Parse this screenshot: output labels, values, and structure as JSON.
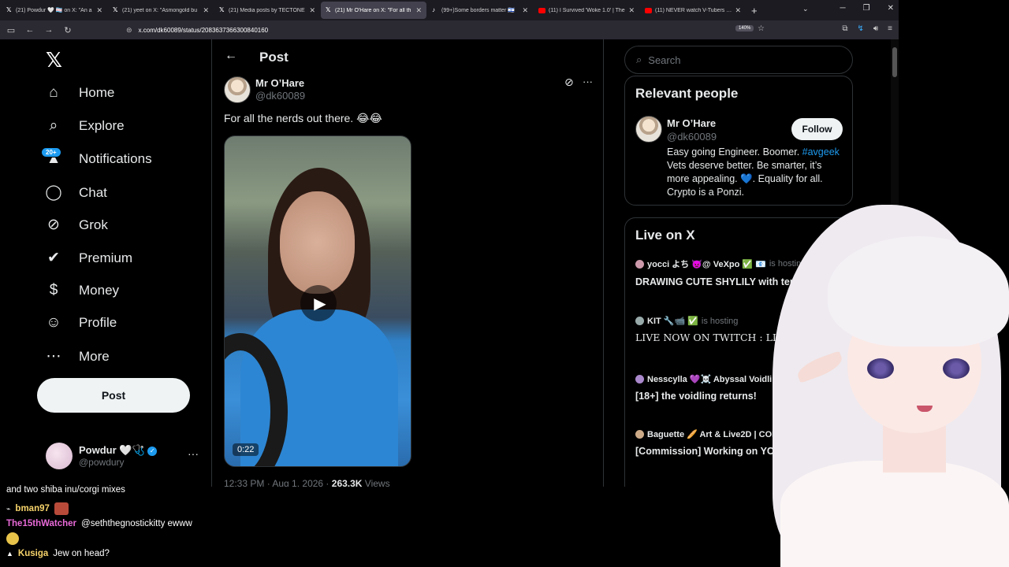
{
  "browser": {
    "tabs": [
      {
        "icon": "x-logo-icon",
        "title": "(21) Powdur 🤍 🏳️‍⚧️ on X: \"An a"
      },
      {
        "icon": "x-logo-icon",
        "title": "(21) yeet on X: \"Asmongold bu"
      },
      {
        "icon": "x-logo-icon",
        "title": "(21) Media posts by TECTONE"
      },
      {
        "icon": "x-logo-icon",
        "title": "(21) Mr O'Hare on X: \"For all th"
      },
      {
        "icon": "tiktok-icon",
        "title": "(99+)Some borders matter 🇮🇱"
      },
      {
        "icon": "youtube-icon",
        "title": "(11) I Survived 'Woke 1.0' | The"
      },
      {
        "icon": "youtube-icon",
        "title": "(11) NEVER watch V-Tubers - Y"
      }
    ],
    "active_tab": 3,
    "url": "x.com/dk60089/status/2083637366300840160",
    "zoom": "140%"
  },
  "nav": {
    "items": [
      {
        "label": "Home",
        "icon": "home-icon",
        "glyph": "⌂"
      },
      {
        "label": "Explore",
        "icon": "search-icon",
        "glyph": "⌕"
      },
      {
        "label": "Notifications",
        "icon": "bell-icon",
        "glyph": "▲"
      },
      {
        "label": "Chat",
        "icon": "chat-icon",
        "glyph": "◯"
      },
      {
        "label": "Grok",
        "icon": "grok-icon",
        "glyph": "⊘"
      },
      {
        "label": "Premium",
        "icon": "premium-icon",
        "glyph": "✔"
      },
      {
        "label": "Money",
        "icon": "money-icon",
        "glyph": "$"
      },
      {
        "label": "Profile",
        "icon": "profile-icon",
        "glyph": "☺"
      },
      {
        "label": "More",
        "icon": "more-icon",
        "glyph": "⋯"
      }
    ],
    "notif_badge": "20+",
    "post_button": "Post",
    "account": {
      "name": "Powdur 🤍🩺",
      "handle": "@powdury"
    }
  },
  "post": {
    "header": "Post",
    "author_name": "Mr O’Hare",
    "author_handle": "@dk60089",
    "text": "For all the nerds out there. 😂😂",
    "video_duration": "0:22",
    "time": "12:33 PM · Aug 1, 2026 · ",
    "views_count": "263.3K",
    "views_label": " Views"
  },
  "search": {
    "placeholder": "Search"
  },
  "relevant": {
    "title": "Relevant people",
    "name": "Mr O’Hare",
    "handle": "@dk60089",
    "follow": "Follow",
    "bio_before": "Easy going Engineer. Boomer. ",
    "bio_tag": "#avgeek",
    "bio_after": " Vets deserve better. Be smarter, it’s more appealing. 💙. Equality for all. Crypto is a Ponzi."
  },
  "live": {
    "title": "Live on X",
    "items": [
      {
        "host": "yocci よち 👿@ VeXpo ✅ 📧",
        "is_hosting": "is hosting",
        "title": "DRAWING CUTE SHYLILY with tentacles :) ~"
      },
      {
        "host": "KIT 🔧📹 ✅",
        "is_hosting": "is hosting",
        "title": "LIVE NOW ON TWITCH : LINK IN BIO"
      },
      {
        "host": "Nesscylla 💜☠️ Abyssal Voidling",
        "is_hosting": "",
        "title": "[18+] the voidling returns!"
      },
      {
        "host": "Baguette 🥖 Art & Live2D | COM...",
        "is_hosting": "",
        "title": "[Commission] Working on YCH Chibi model!"
      }
    ]
  },
  "chat": [
    {
      "user": "",
      "text": "and two shiba inu/corgi mixes",
      "color": "#ffffff"
    },
    {
      "user": "bman97",
      "text": "",
      "color": "#f7d46b"
    },
    {
      "user": "The15thWatcher",
      "text": "@seththegnostickitty ewww",
      "color": "#e86ad8"
    },
    {
      "user": "Kusiga",
      "text": "Jew on head?",
      "color": "#f7d46b"
    }
  ],
  "colors": {
    "accent": "#1d9bf0",
    "bg": "#000000",
    "border": "#2f3336",
    "muted": "#71767b"
  }
}
